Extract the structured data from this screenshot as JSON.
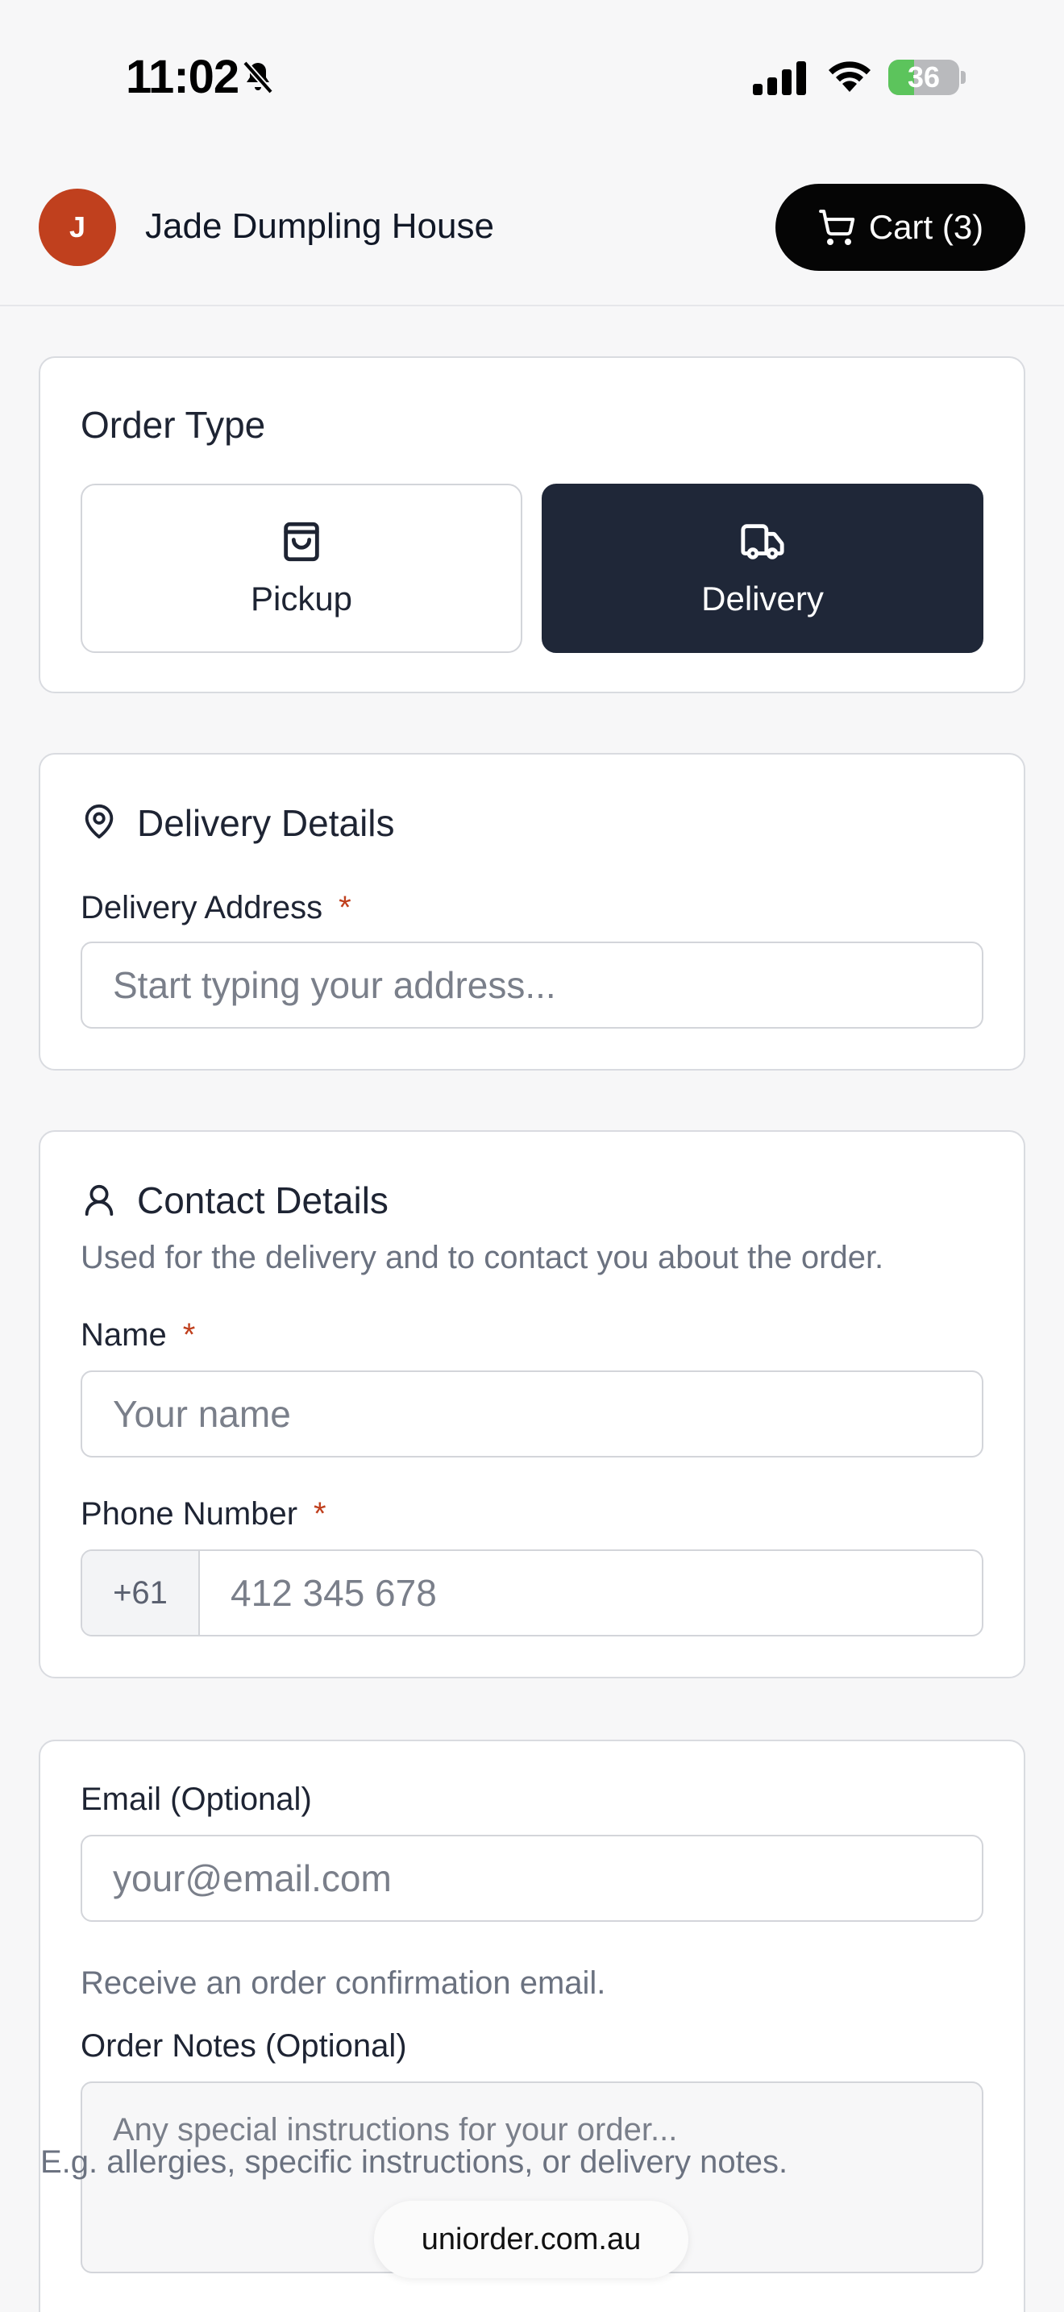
{
  "status_bar": {
    "time": "11:02",
    "battery_level": "36",
    "battery_percent": 36,
    "icons": [
      "bell-slash-icon",
      "signal-icon",
      "wifi-icon",
      "battery-charging-icon"
    ]
  },
  "header": {
    "avatar_initial": "J",
    "restaurant_name": "Jade Dumpling House",
    "cart_label": "Cart (3)",
    "colors": {
      "avatar": "#c0401e",
      "cart_button": "#050505"
    }
  },
  "order_type": {
    "title": "Order Type",
    "options": [
      {
        "label": "Pickup",
        "icon": "shopping-bag-icon",
        "selected": false
      },
      {
        "label": "Delivery",
        "icon": "truck-icon",
        "selected": true
      }
    ],
    "colors": {
      "selected_bg": "#1f2738"
    }
  },
  "delivery": {
    "title": "Delivery Details",
    "icon": "map-pin-icon",
    "address_label": "Delivery Address",
    "required_mark": "*",
    "address_placeholder": "Start typing your address...",
    "address_value": ""
  },
  "contact": {
    "title": "Contact Details",
    "icon": "user-icon",
    "description": "Used for the delivery and to contact you about the order.",
    "name_label": "Name",
    "name_placeholder": "Your name",
    "name_value": "",
    "phone_label": "Phone Number",
    "phone_prefix": "+61",
    "phone_placeholder": "412 345 678",
    "phone_value": "",
    "required_mark": "*"
  },
  "extras": {
    "email_label": "Email (Optional)",
    "email_placeholder": "your@email.com",
    "email_value": "",
    "email_helper": "Receive an order confirmation email.",
    "notes_label": "Order Notes (Optional)",
    "notes_placeholder": "Any special instructions for your order...",
    "notes_value": "",
    "notes_helper_partial": "E.g. allergies, specific instructions, or delivery notes."
  },
  "browser": {
    "url": "uniorder.com.au"
  }
}
